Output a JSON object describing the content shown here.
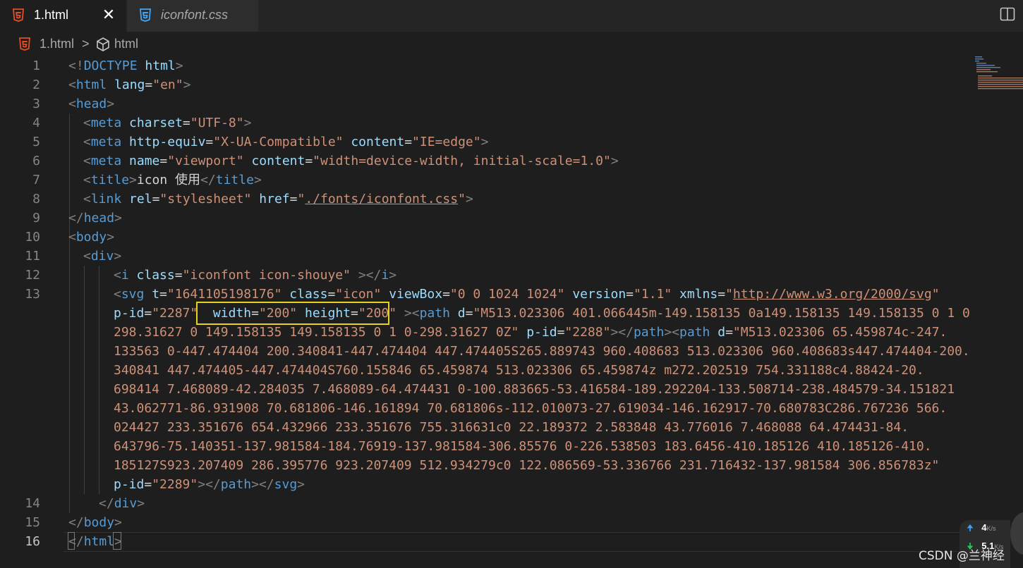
{
  "tabs": [
    {
      "label": "1.html",
      "icon": "html5-icon",
      "active": true,
      "close": "✕"
    },
    {
      "label": "iconfont.css",
      "icon": "css3-icon",
      "active": false
    }
  ],
  "breadcrumb": {
    "file": "1.html",
    "separator": ">",
    "symbol": "html"
  },
  "line_numbers": [
    "1",
    "2",
    "3",
    "4",
    "5",
    "6",
    "7",
    "8",
    "9",
    "10",
    "11",
    "12",
    "13",
    "14",
    "15",
    "16"
  ],
  "code": {
    "l1": {
      "open": "<!",
      "tag": "DOCTYPE",
      "attr": "html",
      "close": ">"
    },
    "l2": {
      "open": "<",
      "tag": "html",
      "attr": "lang",
      "eq": "=",
      "val": "\"en\"",
      "close": ">"
    },
    "l3": {
      "open": "<",
      "tag": "head",
      "close": ">"
    },
    "l4": {
      "open": "<",
      "tag": "meta",
      "attr": "charset",
      "eq": "=",
      "val": "\"UTF-8\"",
      "close": ">"
    },
    "l5": {
      "open": "<",
      "tag": "meta",
      "a1": "http-equiv",
      "eq": "=",
      "v1": "\"X-UA-Compatible\"",
      "a2": "content",
      "v2": "\"IE=edge\"",
      "close": ">"
    },
    "l6": {
      "open": "<",
      "tag": "meta",
      "a1": "name",
      "eq": "=",
      "v1": "\"viewport\"",
      "a2": "content",
      "v2": "\"width=device-width, initial-scale=1.0\"",
      "close": ">"
    },
    "l7": {
      "open": "<",
      "tag": "title",
      "close": ">",
      "text": "icon 使用",
      "end_open": "</",
      "end_tag": "title",
      "end_close": ">"
    },
    "l8": {
      "open": "<",
      "tag": "link",
      "a1": "rel",
      "eq": "=",
      "v1": "\"stylesheet\"",
      "a2": "href",
      "q": "\"",
      "href": "./fonts/iconfont.css",
      "close": ">"
    },
    "l9": {
      "open": "</",
      "tag": "head",
      "close": ">"
    },
    "l10": {
      "open": "<",
      "tag": "body",
      "close": ">"
    },
    "l11": {
      "open": "<",
      "tag": "div",
      "close": ">"
    },
    "l12": {
      "open": "<",
      "tag": "i",
      "attr": "class",
      "eq": "=",
      "val": "\"iconfont icon-shouye\"",
      "close": " >",
      "end_open": "</",
      "end_tag": "i",
      "end_close": ">"
    },
    "l13": {
      "r1": {
        "open": "<",
        "tag": "svg",
        "a1": "t",
        "eq": "=",
        "v1": "\"1641105198176\"",
        "a2": "class",
        "v2": "\"icon\"",
        "a3": "viewBox",
        "v3": "\"0 0 1024 1024\"",
        "a4": "version",
        "v4": "\"1.1\"",
        "a5": "xmlns",
        "q": "\"",
        "v5": "http://www.w3.org/2000/svg"
      },
      "r2": {
        "a1": "p-id",
        "eq": "=",
        "v1": "\"2287\"",
        "a2": "width",
        "v2": "\"200\"",
        "a3": "height",
        "v3": "\"200\"",
        "close": ">",
        "open": "<",
        "tag": "path",
        "a4": "d",
        "v4": "\"M513.023306 401.066445m-149.158135 0a149.158135 149.158135 0 1 0"
      },
      "r3": {
        "v": "298.31627 0 149.158135 149.158135 0 1 0-298.31627 0Z\"",
        "a": "p-id",
        "eq": "=",
        "v2": "\"2288\"",
        "close": ">",
        "end_open": "</",
        "end_tag": "path",
        "open": "<",
        "tag": "path",
        "a2": "d",
        "v3": "\"M513.023306 65.459874c-247."
      },
      "r4": "133563 0-447.474404 200.340841-447.474404 447.474405S265.889743 960.408683 513.023306 960.408683s447.474404-200.",
      "r5": "340841 447.474405-447.474404S760.155846 65.459874 513.023306 65.459874z m272.202519 754.331188c4.88424-20.",
      "r6": "698414 7.468089-42.284035 7.468089-64.474431 0-100.883665-53.416584-189.292204-133.508714-238.484579-34.151821",
      "r7": "43.062771-86.931908 70.681806-146.161894 70.681806s-112.010073-27.619034-146.162917-70.680783C286.767236 566.",
      "r8": "024427 233.351676 654.432966 233.351676 755.316631c0 22.189372 2.583848 43.776016 7.468088 64.474431-84.",
      "r9": "643796-75.140351-137.981584-184.76919-137.981584-306.85576 0-226.538503 183.6456-410.185126 410.185126-410.",
      "r10": "185127S923.207409 286.395776 923.207409 512.934279c0 122.086569-53.336766 231.716432-137.981584 306.856783z\"",
      "r11": {
        "a": "p-id",
        "eq": "=",
        "v": "\"2289\"",
        "close": ">",
        "end_open": "</",
        "t1": "path",
        "t2": "svg"
      }
    },
    "l14": {
      "open": "</",
      "tag": "div",
      "close": ">"
    },
    "l15": {
      "open": "</",
      "tag": "body",
      "close": ">"
    },
    "l16": {
      "open": "</",
      "tag": "html",
      "close": ">"
    }
  },
  "network": {
    "up_arrow": "🠉",
    "down_arrow": "🠋",
    "up_value": "4",
    "up_unit": "K/s",
    "down_value": "5.1",
    "down_unit": "K/s"
  },
  "watermark": "CSDN @兰神经",
  "colors": {
    "background": "#1e1e1e",
    "tag": "#569cd6",
    "attribute": "#9cdcfe",
    "string": "#ce9178",
    "punctuation": "#808080",
    "highlight_box": "#e8d21d"
  }
}
